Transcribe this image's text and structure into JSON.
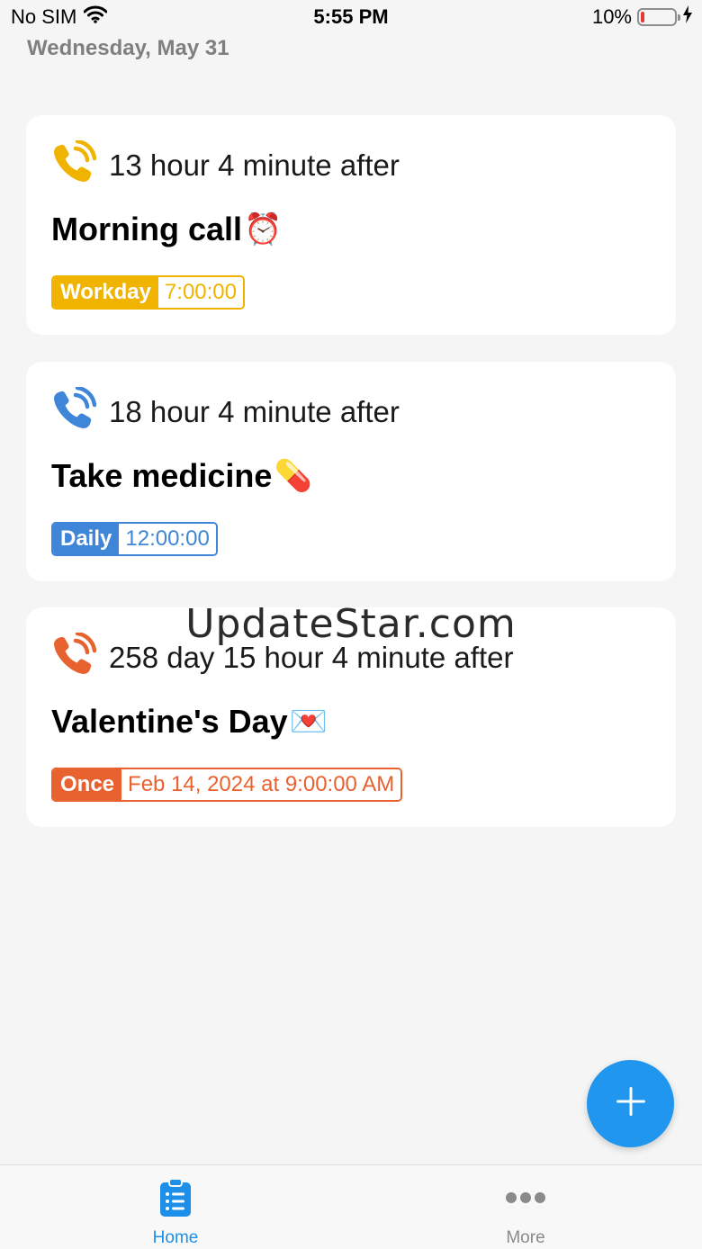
{
  "status_bar": {
    "carrier": "No SIM",
    "time": "5:55 PM",
    "battery": "10%",
    "battery_level": 0.1,
    "battery_color": "#e53935"
  },
  "date": "Wednesday, May 31",
  "alarms": [
    {
      "countdown": "13 hour 4 minute after",
      "title": "Morning call",
      "emoji": "⏰",
      "repeat": "Workday",
      "time": "7:00:00",
      "color": "#f0b400",
      "icon": "phone-ringing-icon"
    },
    {
      "countdown": "18 hour 4 minute after",
      "title": "Take medicine",
      "emoji": "💊",
      "repeat": "Daily",
      "time": "12:00:00",
      "color": "#3f86d8",
      "icon": "phone-ringing-icon"
    },
    {
      "countdown": "258 day 15 hour 4 minute after",
      "title": "Valentine's Day",
      "emoji": "💌",
      "repeat": "Once",
      "time": "Feb 14, 2024 at 9:00:00 AM",
      "color": "#e8622f",
      "icon": "phone-ringing-icon"
    }
  ],
  "watermark": "UpdateStar.com",
  "fab": {
    "icon": "plus-icon",
    "color": "#2196ee"
  },
  "tabs": [
    {
      "label": "Home",
      "icon": "clipboard-list-icon",
      "active": true,
      "color": "#1e8fe8"
    },
    {
      "label": "More",
      "icon": "more-dots-icon",
      "active": false,
      "color": "#8a8a8a"
    }
  ]
}
